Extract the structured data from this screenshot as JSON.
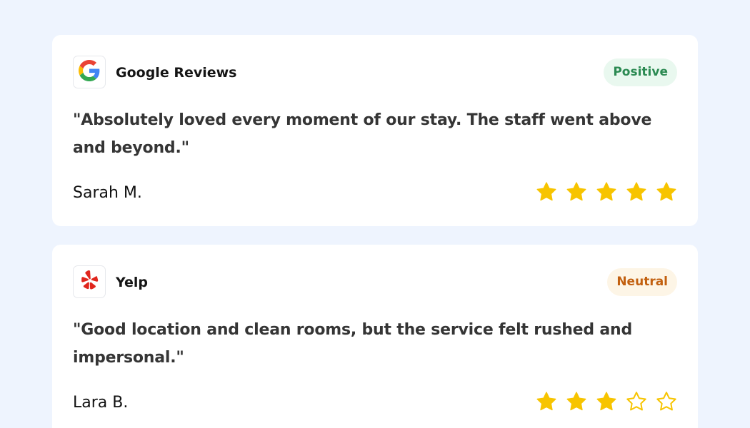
{
  "reviews": [
    {
      "source": "Google Reviews",
      "source_icon": "google-logo-icon",
      "sentiment": "Positive",
      "quote": "\"Absolutely loved every moment of our stay. The staff went above and beyond.\"",
      "author": "Sarah M.",
      "rating": 5,
      "max_rating": 5
    },
    {
      "source": "Yelp",
      "source_icon": "yelp-logo-icon",
      "sentiment": "Neutral",
      "quote": "\"Good location and clean rooms, but the service felt rushed and impersonal.\"",
      "author": "Lara B.",
      "rating": 3,
      "max_rating": 5
    }
  ],
  "colors": {
    "page_background": "#eef4fe",
    "card_background": "#ffffff",
    "star_filled": "#f7c400",
    "star_empty_outline": "#f7c400",
    "positive_badge_bg": "#e9f8ef",
    "positive_badge_text": "#2b8a52",
    "neutral_badge_bg": "#fdf5e6",
    "neutral_badge_text": "#c2600f",
    "google_blue": "#4285F4",
    "google_red": "#EA4335",
    "google_yellow": "#FBBC05",
    "google_green": "#34A853",
    "yelp_red": "#e0261d"
  }
}
